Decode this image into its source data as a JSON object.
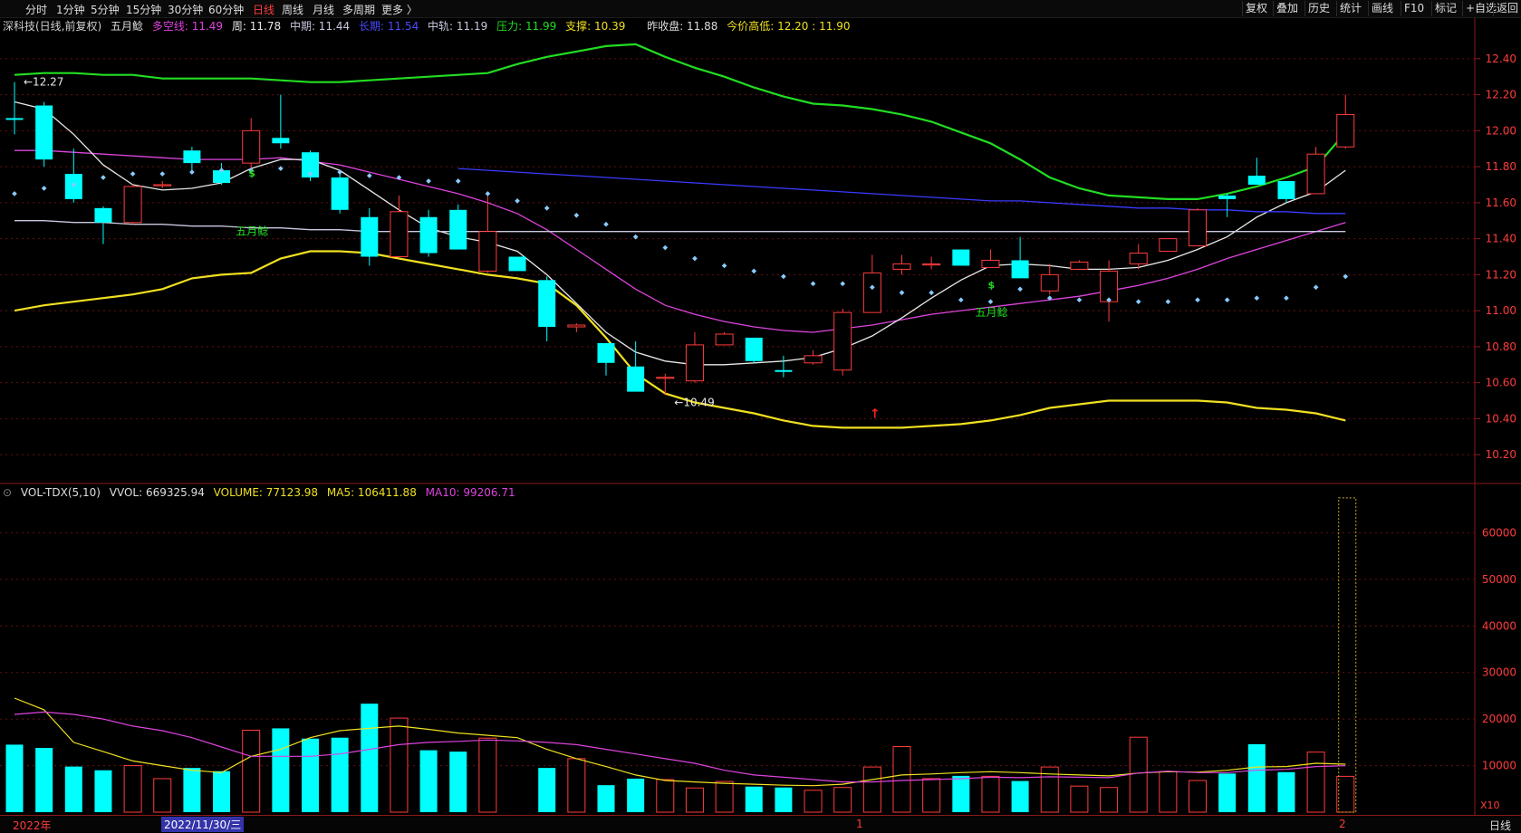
{
  "toolbar": {
    "period_tabs": [
      "分时",
      "1分钟",
      "5分钟",
      "15分钟",
      "30分钟",
      "60分钟",
      "日线",
      "周线",
      "月线",
      "多周期",
      "更多 〉"
    ],
    "active_tab": "日线",
    "right_buttons": [
      "复权",
      "叠加",
      "历史",
      "统计",
      "画线",
      "F10",
      "标记",
      "+自选",
      "返回"
    ]
  },
  "info": {
    "stock": "深科技(日线,前复权)",
    "indicator": "五月鲶",
    "duokong": "多空线: 11.49",
    "zhou": "周: 11.78",
    "zhongqi": "中期: 11.44",
    "changqi": "长期: 11.54",
    "zhonggui": "中轨: 11.19",
    "yali": "压力: 11.99",
    "zhicheng": "支撑: 10.39",
    "prevclose": "昨收盘: 11.88",
    "todayhl": "今价高低: 12.20 : 11.90"
  },
  "volinfo": {
    "name": "VOL-TDX(5,10)",
    "vvol": "VVOL: 669325.94",
    "volume": "VOLUME: 77123.98",
    "ma5": "MA5: 106411.88",
    "ma10": "MA10: 99206.71"
  },
  "bottom": {
    "year": "2022年",
    "selected_date": "2022/11/30/三",
    "mark1": "1",
    "mark2": "2",
    "period": "日线",
    "scale": "X10"
  },
  "colors": {
    "up": "#ff3c3c",
    "down": "#00ffff",
    "duokong": "#dd44dd",
    "zhou": "#e8e8e8",
    "changqi": "#3a3aff",
    "zhonggui": "#c8c8e0",
    "yali": "#22dd22",
    "zhicheng": "#f0e020",
    "dots": "#88ccff"
  },
  "chart_data": [
    {
      "type": "candlestick",
      "title": "深科技(日线,前复权)",
      "ylim": [
        10.05,
        12.55
      ],
      "yticks": [
        10.2,
        10.4,
        10.6,
        10.8,
        11.0,
        11.2,
        11.4,
        11.6,
        11.8,
        12.0,
        12.2,
        12.4
      ],
      "candles": [
        [
          12.07,
          12.06,
          12.27,
          11.98
        ],
        [
          12.14,
          11.84,
          12.16,
          11.8
        ],
        [
          11.76,
          11.62,
          11.9,
          11.6
        ],
        [
          11.57,
          11.49,
          11.58,
          11.37
        ],
        [
          11.49,
          11.69,
          11.7,
          11.48
        ],
        [
          11.7,
          11.7,
          11.72,
          11.68
        ],
        [
          11.89,
          11.82,
          11.91,
          11.78
        ],
        [
          11.78,
          11.71,
          11.82,
          11.7
        ],
        [
          11.82,
          12.0,
          12.07,
          11.79
        ],
        [
          11.96,
          11.93,
          12.2,
          11.9
        ],
        [
          11.88,
          11.74,
          11.89,
          11.72
        ],
        [
          11.74,
          11.56,
          11.76,
          11.54
        ],
        [
          11.52,
          11.3,
          11.57,
          11.25
        ],
        [
          11.3,
          11.55,
          11.64,
          11.3
        ],
        [
          11.52,
          11.32,
          11.56,
          11.3
        ],
        [
          11.56,
          11.34,
          11.59,
          11.34
        ],
        [
          11.22,
          11.44,
          11.64,
          11.21
        ],
        [
          11.3,
          11.22,
          11.3,
          11.22
        ],
        [
          11.17,
          10.91,
          11.19,
          10.83
        ],
        [
          10.91,
          10.92,
          10.93,
          10.88
        ],
        [
          10.82,
          10.71,
          10.82,
          10.64
        ],
        [
          10.69,
          10.55,
          10.83,
          10.55
        ],
        [
          10.63,
          10.63,
          10.65,
          10.53
        ],
        [
          10.61,
          10.81,
          10.88,
          10.6
        ],
        [
          10.81,
          10.87,
          10.88,
          10.81
        ],
        [
          10.85,
          10.72,
          10.85,
          10.71
        ],
        [
          10.67,
          10.66,
          10.75,
          10.63
        ],
        [
          10.71,
          10.75,
          10.78,
          10.7
        ],
        [
          10.67,
          10.99,
          11.01,
          10.64
        ],
        [
          10.99,
          11.21,
          11.31,
          10.99
        ],
        [
          11.23,
          11.26,
          11.31,
          11.2
        ],
        [
          11.26,
          11.26,
          11.3,
          11.23
        ],
        [
          11.34,
          11.25,
          11.34,
          11.25
        ],
        [
          11.24,
          11.28,
          11.34,
          11.24
        ],
        [
          11.28,
          11.18,
          11.41,
          11.18
        ],
        [
          11.11,
          11.2,
          11.26,
          11.09
        ],
        [
          11.23,
          11.27,
          11.28,
          11.23
        ],
        [
          11.05,
          11.22,
          11.28,
          10.94
        ],
        [
          11.26,
          11.32,
          11.37,
          11.23
        ],
        [
          11.33,
          11.4,
          11.4,
          11.33
        ],
        [
          11.36,
          11.56,
          11.57,
          11.36
        ],
        [
          11.64,
          11.62,
          11.65,
          11.52
        ],
        [
          11.75,
          11.7,
          11.85,
          11.7
        ],
        [
          11.72,
          11.62,
          11.72,
          11.6
        ],
        [
          11.65,
          11.87,
          11.91,
          11.65
        ],
        [
          11.91,
          12.09,
          12.2,
          11.9
        ]
      ],
      "series": [
        {
          "name": "多空线",
          "values": [
            11.89,
            11.89,
            11.88,
            11.87,
            11.86,
            11.85,
            11.84,
            11.84,
            11.84,
            11.85,
            11.83,
            11.81,
            11.77,
            11.73,
            11.69,
            11.65,
            11.6,
            11.54,
            11.45,
            11.34,
            11.23,
            11.12,
            11.03,
            10.98,
            10.94,
            10.91,
            10.89,
            10.88,
            10.9,
            10.92,
            10.95,
            10.98,
            11.0,
            11.02,
            11.04,
            11.06,
            11.08,
            11.11,
            11.14,
            11.18,
            11.23,
            11.29,
            11.34,
            11.39,
            11.44,
            11.49
          ]
        },
        {
          "name": "周",
          "values": [
            12.16,
            12.12,
            11.98,
            11.81,
            11.7,
            11.67,
            11.68,
            11.71,
            11.79,
            11.84,
            11.84,
            11.78,
            11.67,
            11.56,
            11.46,
            11.41,
            11.38,
            11.33,
            11.2,
            11.04,
            10.88,
            10.77,
            10.72,
            10.7,
            10.7,
            10.71,
            10.72,
            10.74,
            10.79,
            10.86,
            10.96,
            11.07,
            11.17,
            11.25,
            11.26,
            11.25,
            11.23,
            11.23,
            11.24,
            11.28,
            11.34,
            11.41,
            11.52,
            11.6,
            11.66,
            11.78
          ]
        },
        {
          "name": "中期",
          "values": [
            11.5,
            11.5,
            11.49,
            11.49,
            11.48,
            11.48,
            11.47,
            11.47,
            11.46,
            11.46,
            11.45,
            11.45,
            11.44,
            11.44,
            11.44,
            11.44,
            11.44,
            11.44,
            11.44,
            11.44,
            11.44,
            11.44,
            11.44,
            11.44,
            11.44,
            11.44,
            11.44,
            11.44,
            11.44,
            11.44,
            11.44,
            11.44,
            11.44,
            11.44,
            11.44,
            11.44,
            11.44,
            11.44,
            11.44,
            11.44,
            11.44,
            11.44,
            11.44,
            11.44,
            11.44,
            11.44
          ]
        },
        {
          "name": "长期",
          "values": [
            null,
            null,
            null,
            null,
            null,
            null,
            null,
            null,
            null,
            null,
            null,
            null,
            null,
            null,
            null,
            11.79,
            11.78,
            11.77,
            11.76,
            11.75,
            11.74,
            11.73,
            11.72,
            11.71,
            11.7,
            11.69,
            11.68,
            11.67,
            11.66,
            11.65,
            11.64,
            11.63,
            11.62,
            11.61,
            11.61,
            11.6,
            11.59,
            11.58,
            11.57,
            11.57,
            11.56,
            11.56,
            11.55,
            11.55,
            11.54,
            11.54
          ]
        },
        {
          "name": "压力",
          "values": [
            12.31,
            12.32,
            12.32,
            12.31,
            12.31,
            12.29,
            12.29,
            12.29,
            12.29,
            12.28,
            12.27,
            12.27,
            12.28,
            12.29,
            12.3,
            12.31,
            12.32,
            12.37,
            12.41,
            12.44,
            12.47,
            12.48,
            12.41,
            12.35,
            12.3,
            12.24,
            12.19,
            12.15,
            12.14,
            12.12,
            12.09,
            12.05,
            11.99,
            11.93,
            11.84,
            11.74,
            11.68,
            11.64,
            11.63,
            11.62,
            11.62,
            11.65,
            11.69,
            11.74,
            11.8,
            11.99
          ]
        },
        {
          "name": "支撑",
          "values": [
            11.0,
            11.03,
            11.05,
            11.07,
            11.09,
            11.12,
            11.18,
            11.2,
            11.21,
            11.29,
            11.33,
            11.33,
            11.32,
            11.29,
            11.26,
            11.23,
            11.2,
            11.18,
            11.15,
            11.03,
            10.85,
            10.65,
            10.54,
            10.49,
            10.46,
            10.43,
            10.39,
            10.36,
            10.35,
            10.35,
            10.35,
            10.36,
            10.37,
            10.39,
            10.42,
            10.46,
            10.48,
            10.5,
            10.5,
            10.5,
            10.5,
            10.49,
            10.46,
            10.45,
            10.43,
            10.39
          ]
        },
        {
          "name": "中轨",
          "values": [
            11.65,
            11.68,
            11.7,
            11.74,
            11.76,
            11.76,
            11.77,
            11.78,
            11.78,
            11.79,
            11.76,
            11.77,
            11.75,
            11.74,
            11.72,
            11.72,
            11.65,
            11.61,
            11.57,
            11.53,
            11.48,
            11.41,
            11.35,
            11.29,
            11.25,
            11.22,
            11.19,
            11.15,
            11.15,
            11.13,
            11.1,
            11.1,
            11.06,
            11.05,
            11.12,
            11.07,
            11.06,
            11.06,
            11.05,
            11.05,
            11.06,
            11.06,
            11.07,
            11.07,
            11.13,
            11.19
          ]
        }
      ],
      "annotations": [
        {
          "label": "12.27",
          "x": 0,
          "y": 12.27
        },
        {
          "label": "10.49",
          "x": 22,
          "y": 10.49
        },
        {
          "label": "五月鲶",
          "x": 8,
          "y": 11.44
        },
        {
          "label": "五月鲶",
          "x": 33,
          "y": 10.99
        }
      ],
      "markers": [
        {
          "symbol": "$",
          "x": 8,
          "y": 11.77
        },
        {
          "symbol": "$",
          "x": 33,
          "y": 11.15
        },
        {
          "symbol": "↑",
          "x": 29,
          "y": 10.43
        }
      ]
    },
    {
      "type": "bar",
      "title": "VOL-TDX(5,10)",
      "ylim": [
        0,
        70000
      ],
      "yticks": [
        10000,
        20000,
        30000,
        40000,
        50000,
        60000
      ],
      "volumes": [
        14500,
        13800,
        9800,
        9000,
        10000,
        7200,
        9500,
        8800,
        17600,
        18000,
        15800,
        16000,
        23300,
        20200,
        13300,
        13000,
        15900,
        null,
        9500,
        11500,
        5800,
        7200,
        7000,
        5200,
        6600,
        5500,
        5300,
        4700,
        5300,
        9700,
        14100,
        7200,
        7800,
        7700,
        6700,
        9700,
        5600,
        5300,
        16100,
        8700,
        6800,
        8300,
        14600,
        8600,
        12900,
        7700
      ],
      "ghost_volume": [
        45,
        67500
      ],
      "series": [
        {
          "name": "VOLUME",
          "values": [
            24500,
            22000,
            15000,
            13000,
            11000,
            10000,
            9000,
            8500,
            12000,
            13500,
            16000,
            17500,
            18000,
            18500,
            17800,
            17000,
            16500,
            16000,
            13500,
            11500,
            9800,
            8000,
            6800,
            6500,
            6200,
            6000,
            5800,
            5700,
            6000,
            7000,
            8000,
            8200,
            8500,
            8700,
            8500,
            8200,
            8000,
            7800,
            8400,
            8700,
            8600,
            9000,
            9700,
            9800,
            10500,
            10300
          ]
        },
        {
          "name": "MA10",
          "values": [
            21000,
            21500,
            21000,
            20000,
            18500,
            17500,
            16000,
            14000,
            12000,
            12000,
            12000,
            12500,
            13500,
            14500,
            15000,
            15200,
            15500,
            15300,
            15000,
            14500,
            13500,
            12500,
            11500,
            10500,
            9000,
            8000,
            7500,
            7000,
            6500,
            6500,
            6800,
            7000,
            7200,
            7500,
            7400,
            7600,
            7500,
            7400,
            8400,
            8800,
            8500,
            8500,
            9000,
            9200,
            9800,
            10000
          ]
        }
      ]
    }
  ]
}
